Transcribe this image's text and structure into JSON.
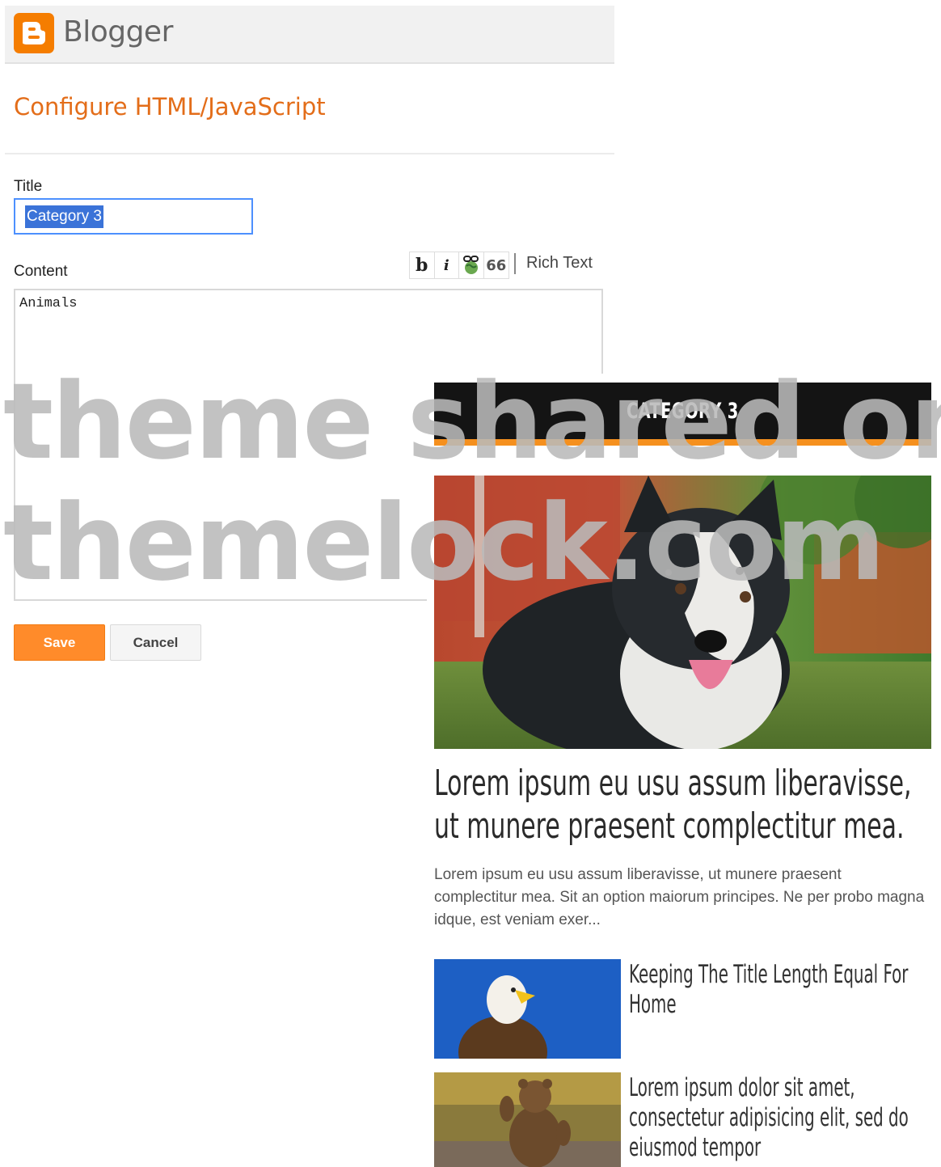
{
  "header": {
    "brand": "Blogger"
  },
  "dialog": {
    "heading": "Configure HTML/JavaScript",
    "title_label": "Title",
    "title_value": "Category 3",
    "content_label": "Content",
    "toolbar": {
      "bold": "b",
      "italic": "i",
      "quote": "66",
      "mode": "Rich Text"
    },
    "content_value": "Animals",
    "save_label": "Save",
    "cancel_label": "Cancel"
  },
  "widget": {
    "category_title": "CATEGORY 3",
    "featured": {
      "title": "Lorem ipsum eu usu assum liberavisse, ut munere praesent complectitur mea.",
      "excerpt": "Lorem ipsum eu usu assum liberavisse, ut munere praesent complectitur mea. Sit an option maiorum principes. Ne per probo magna idque, est veniam exer..."
    },
    "items": [
      {
        "title": "Keeping The Title Length Equal For Home"
      },
      {
        "title": "Lorem ipsum dolor sit amet, consectetur adipisicing elit, sed do eiusmod tempor"
      }
    ]
  },
  "watermark": {
    "line1": "theme shared on",
    "line2": "themelock.com"
  },
  "colors": {
    "accent": "#f5901e",
    "heading": "#e36d19",
    "focus": "#4d90fe"
  }
}
